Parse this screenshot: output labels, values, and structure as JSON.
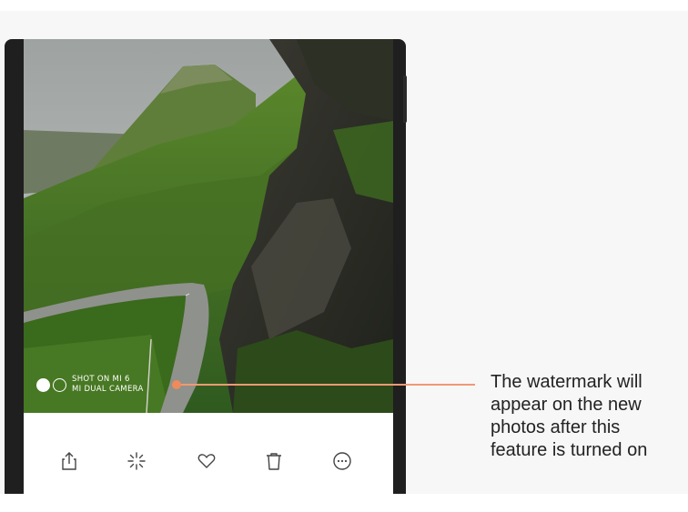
{
  "watermark": {
    "line1": "SHOT ON MI 6",
    "line2": "MI DUAL CAMERA"
  },
  "toolbar": {
    "icons": [
      "share-icon",
      "edit-sparkle-icon",
      "heart-icon",
      "trash-icon",
      "more-icon"
    ]
  },
  "callout": {
    "lines": [
      "The watermark will",
      "appear on the new",
      "photos after this",
      "feature is turned on"
    ]
  },
  "colors": {
    "accent": "#ef8a5c",
    "page_background": "#f7f7f7",
    "phone_body": "#1f1f1f",
    "icon": "#444444"
  }
}
